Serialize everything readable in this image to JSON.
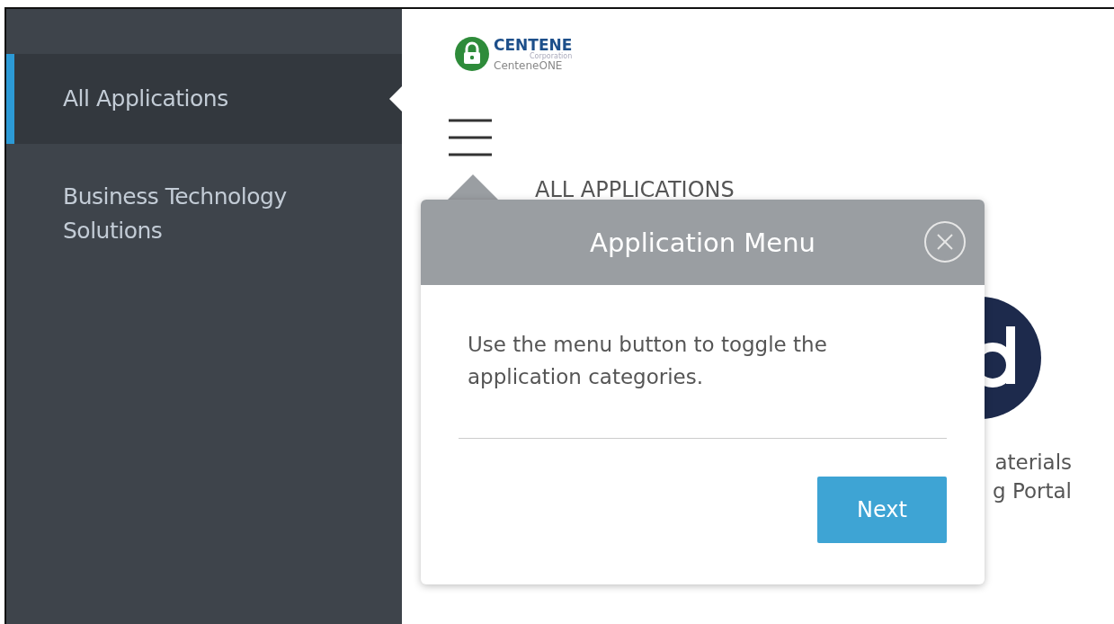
{
  "sidebar": {
    "items": [
      {
        "label": "All Applications",
        "selected": true
      },
      {
        "label": "Business Technology Solutions",
        "selected": false
      }
    ]
  },
  "logo": {
    "name": "CENTENE",
    "subtitle": "Corporation",
    "product": "CenteneONE"
  },
  "heading": "ALL APPLICATIONS",
  "app_card": {
    "lines": [
      "aterials",
      "g Portal"
    ]
  },
  "popover": {
    "title": "Application Menu",
    "body": "Use the menu button to toggle the application categories.",
    "button": "Next"
  }
}
